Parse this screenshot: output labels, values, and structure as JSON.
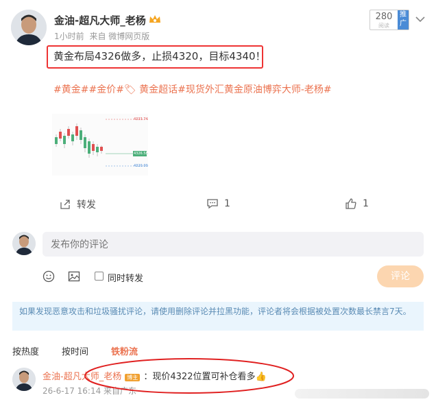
{
  "post": {
    "author": "金油-超凡大师_老杨",
    "time": "1小时前",
    "source": "来自 微博网页版",
    "content": "黄金布局4326做多，止损4320，目标4340！",
    "tags": "#黄金##金价#🏷 黄金超话#现货外汇黄金原油博弈大师-老杨#",
    "recommend": {
      "count": "280",
      "sub": "阅读",
      "tag": "推广"
    },
    "actions": {
      "share": "转发",
      "comments": "1",
      "likes": "1"
    },
    "chart_prices": {
      "top": "4333.74",
      "mid": "4326.58",
      "low": "4320.00"
    }
  },
  "composer": {
    "placeholder": "发布你的评论",
    "forward_label": "同时转发",
    "submit": "评论"
  },
  "notice": "如果发现恶意攻击和垃圾骚扰评论，请使用删除评论并拉黑功能，评论者将会根据被处置次数最长禁言7天。",
  "sort": {
    "hot": "按热度",
    "time": "按时间",
    "fans": "铁粉流"
  },
  "comment": {
    "author": "金油-超凡大师_老杨",
    "badge": "博主",
    "text": "：现价4322位置可补仓看多👍",
    "meta": "26-6-17 16:14 来自广东"
  }
}
